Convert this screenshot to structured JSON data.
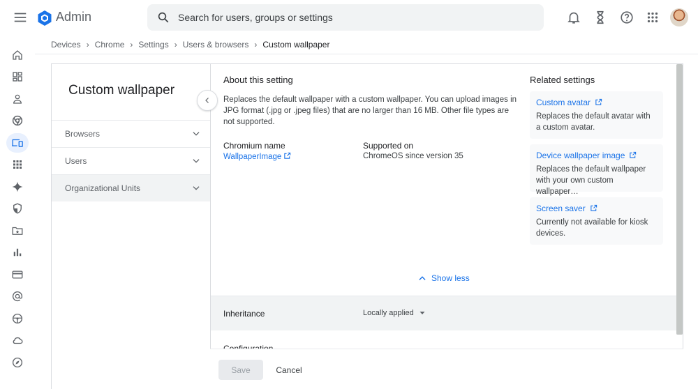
{
  "header": {
    "app_title": "Admin",
    "search_placeholder": "Search for users, groups or settings"
  },
  "icons": {
    "menu": "menu-icon",
    "logo": "google-admin-logo-icon",
    "search": "search-icon",
    "notifications": "bell-icon",
    "tasks": "hourglass-icon",
    "help": "help-icon",
    "apps": "apps-grid-icon",
    "account": "avatar"
  },
  "rail": {
    "items": [
      "home-icon",
      "dashboard-icon",
      "person-icon",
      "chrome-icon",
      "devices-icon",
      "apps-icon",
      "sparkle-icon",
      "security-shield-icon",
      "drive-folder-icon",
      "reports-bar-chart-icon",
      "billing-card-icon",
      "account-at-icon",
      "steering-wheel-icon",
      "cloud-icon",
      "compass-icon"
    ],
    "active_index": 4
  },
  "breadcrumb": {
    "items": [
      "Devices",
      "Chrome",
      "Settings",
      "Users & browsers"
    ],
    "current": "Custom wallpaper"
  },
  "left_panel": {
    "title": "Custom wallpaper",
    "filters": [
      {
        "label": "Browsers"
      },
      {
        "label": "Users"
      },
      {
        "label": "Organizational Units"
      }
    ]
  },
  "about": {
    "heading": "About this setting",
    "description": "Replaces the default wallpaper with a custom wallpaper. You can upload images in JPG format (.jpg or .jpeg files) that are no larger than 16 MB. Other file types are not supported.",
    "chromium_name_label": "Chromium name",
    "chromium_name_value": "WallpaperImage",
    "supported_on_label": "Supported on",
    "supported_on_value": "ChromeOS since version 35",
    "show_less": "Show less"
  },
  "related": {
    "heading": "Related settings",
    "items": [
      {
        "title": "Custom avatar",
        "desc": "Replaces the default avatar with a custom avatar."
      },
      {
        "title": "Device wallpaper image",
        "desc": "Replaces the default wallpaper with your own custom wallpaper…"
      },
      {
        "title": "Screen saver",
        "desc": "Currently not available for kiosk devices."
      }
    ]
  },
  "settings": {
    "inheritance_label": "Inheritance",
    "inheritance_value": "Locally applied",
    "configuration_label": "Configuration"
  },
  "footer": {
    "save": "Save",
    "cancel": "Cancel"
  },
  "colors": {
    "accent": "#1a73e8",
    "active_rail_bg": "#e8f0fe"
  }
}
